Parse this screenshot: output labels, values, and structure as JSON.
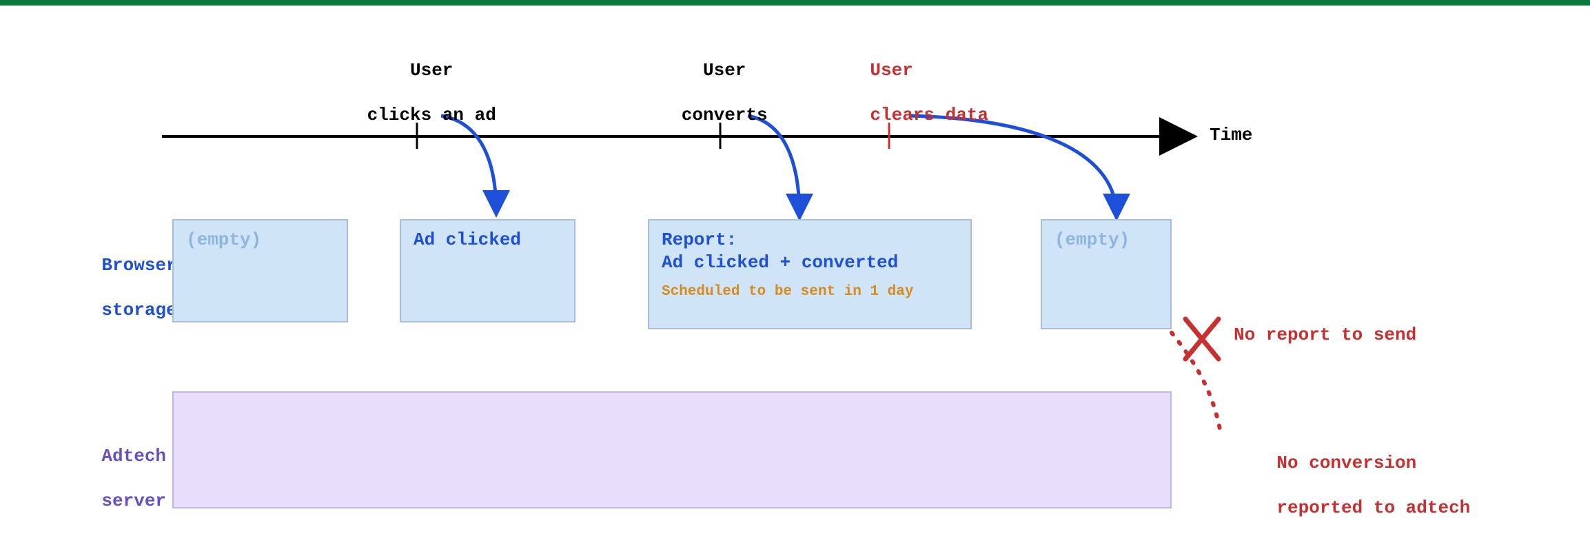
{
  "colors": {
    "blue": "#1e4fd8",
    "lightBlue": "#8fb5df",
    "orange": "#d88a1a",
    "red": "#c83030",
    "storageFill": "#cfe4f7",
    "storageBorder": "#a9bfd8",
    "adtechFill": "#e6defa",
    "adtechBorder": "#c2b4ec",
    "accentGreenBar": "#0a7a3a"
  },
  "timeline": {
    "axis_label": "Time",
    "events": [
      {
        "id": "click",
        "line1": "User",
        "line2": "clicks an ad",
        "color": "black"
      },
      {
        "id": "convert",
        "line1": "User",
        "line2": "converts",
        "color": "black"
      },
      {
        "id": "clear",
        "line1": "User",
        "line2": "clears data",
        "color": "red"
      }
    ]
  },
  "rows": {
    "browser_storage": {
      "label_line1": "Browser",
      "label_line2": "storage",
      "boxes": [
        {
          "id": "empty1",
          "text": "(empty)",
          "style": "faded"
        },
        {
          "id": "clicked",
          "text": "Ad clicked",
          "style": "blue-bold"
        },
        {
          "id": "report",
          "line1": "Report:",
          "line2": "Ad clicked + converted",
          "note": "Scheduled to be sent in 1 day",
          "style": "blue-bold"
        },
        {
          "id": "empty2",
          "text": "(empty)",
          "style": "faded"
        }
      ]
    },
    "adtech_server": {
      "label_line1": "Adtech",
      "label_line2": "server"
    }
  },
  "annotations": {
    "no_report_to_send": "No report to send",
    "no_conversion_line1": "No conversion",
    "no_conversion_line2": "reported to adtech",
    "x_mark": "✗"
  }
}
